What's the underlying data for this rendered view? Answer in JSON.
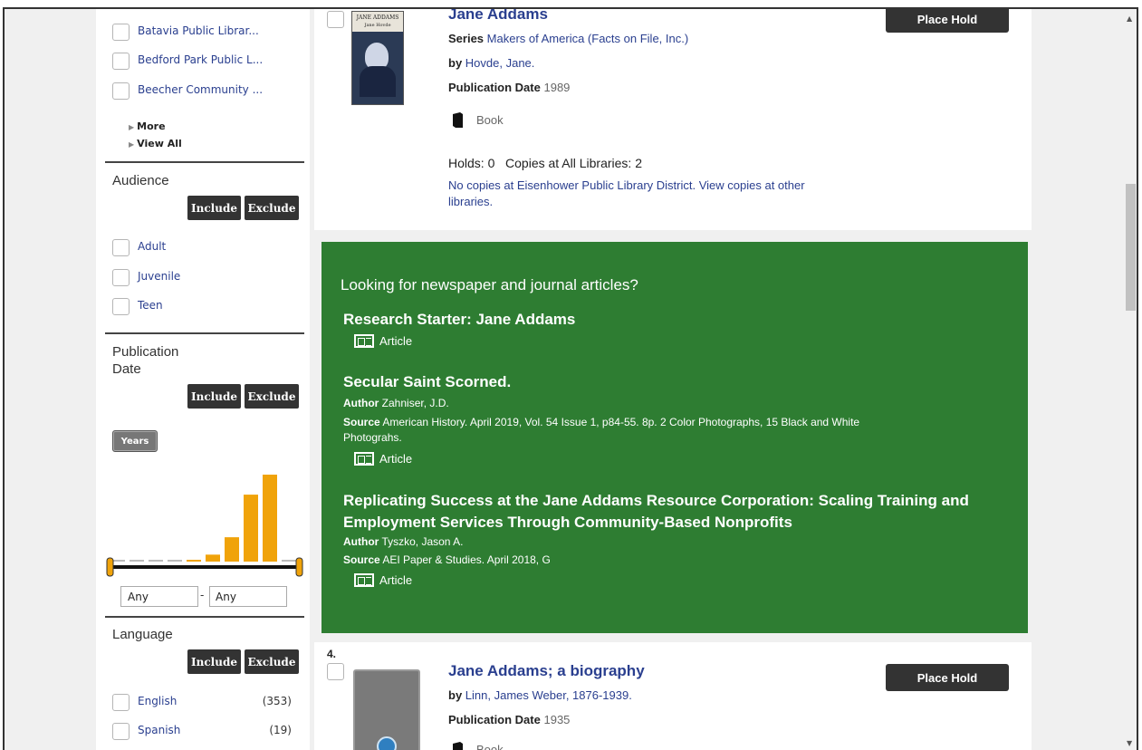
{
  "sidebar": {
    "library_items": [
      {
        "label": "Batavia Public Librar..."
      },
      {
        "label": "Bedford Park Public L..."
      },
      {
        "label": "Beecher Community ..."
      }
    ],
    "more_label": "More",
    "view_all_label": "View All",
    "audience": {
      "heading": "Audience",
      "include_label": "Include",
      "exclude_label": "Exclude",
      "items": [
        {
          "label": "Adult"
        },
        {
          "label": "Juvenile"
        },
        {
          "label": "Teen"
        }
      ]
    },
    "pubdate": {
      "heading_line1": "Publication",
      "heading_line2": "Date",
      "include_label": "Include",
      "exclude_label": "Exclude",
      "years_label": "Years",
      "histogram_values": [
        1,
        1,
        1,
        1,
        2,
        8,
        28,
        77,
        100,
        1
      ],
      "from_value": "Any",
      "separator": "-",
      "to_value": "Any"
    },
    "language": {
      "heading": "Language",
      "include_label": "Include",
      "exclude_label": "Exclude",
      "items": [
        {
          "label": "English",
          "count": "(353)"
        },
        {
          "label": "Spanish",
          "count": "(19)"
        }
      ]
    }
  },
  "results": {
    "item1": {
      "title": "Jane Addams",
      "series_label": "Series",
      "series_value": "Makers of America (Facts on File, Inc.)",
      "by_label": "by",
      "author": "Hovde, Jane.",
      "pubdate_label": "Publication Date",
      "pubdate_value": "1989",
      "format": "Book",
      "holds": "Holds: 0",
      "copies": "Copies at All Libraries: 2",
      "availability_line1": "No copies at Eisenhower Public Library District. View copies at other",
      "availability_line2": "libraries.",
      "hold_button": "Place Hold",
      "cover_title": "JANE ADDAMS",
      "cover_author": "Jane Hovde"
    },
    "articles": {
      "heading": "Looking for newspaper and journal articles?",
      "article_label": "Article",
      "author_label": "Author",
      "source_label": "Source",
      "items": [
        {
          "title": "Research Starter: Jane Addams"
        },
        {
          "title": "Secular Saint Scorned.",
          "author": "Zahniser, J.D.",
          "source_line1": "American History. April 2019, Vol. 54 Issue 1, p84-55. 8p. 2 Color Photographs, 15 Black and White",
          "source_line2": "Photograhs."
        },
        {
          "title_line1": "Replicating Success at the Jane Addams Resource Corporation: Scaling Training and",
          "title_line2": "Employment Services Through Community-Based Nonprofits",
          "author": "Tyszko, Jason A.",
          "source": "AEI Paper & Studies. April 2018, G"
        }
      ]
    },
    "item4": {
      "number": "4.",
      "title": "Jane Addams; a biography",
      "by_label": "by",
      "author": "Linn, James Weber, 1876-1939.",
      "pubdate_label": "Publication Date",
      "pubdate_value": "1935",
      "format": "Book",
      "hold_button": "Place Hold"
    }
  },
  "colors": {
    "link": "#2a3f8f",
    "green_panel": "#2e7d32",
    "histogram_bar": "#f0a30a",
    "button_dark": "#333333"
  }
}
